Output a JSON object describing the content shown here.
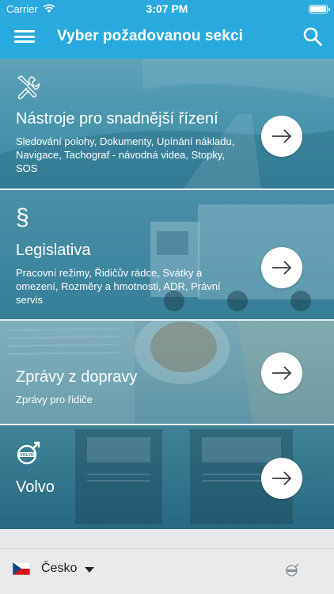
{
  "status_bar": {
    "carrier": "Carrier",
    "time": "3:07 PM"
  },
  "nav": {
    "title": "Vyber požadovanou sekci",
    "menu_icon": "hamburger-menu-icon",
    "search_icon": "search-icon"
  },
  "sections": [
    {
      "icon": "tools-icon",
      "title": "Nástroje pro snadnější řízení",
      "description": "Sledování polohy, Dokumenty, Upínání nákladu, Navigace, Tachograf - návodná videa, Stopky, SOS"
    },
    {
      "icon": "paragraph-icon",
      "icon_glyph": "§",
      "title": "Legislativa",
      "description": "Pracovní režimy, Řidičův rádce, Svátky a omezení, Rozměry a hmotnosti, ADR, Právní servis"
    },
    {
      "title": "Zprávy z dopravy",
      "description": "Zprávy pro řidiče"
    },
    {
      "icon": "volvo-logo-icon",
      "logo_text": "VOLVO",
      "title": "Volvo"
    }
  ],
  "bottom_bar": {
    "language": "Česko",
    "flag_icon": "czech-flag-icon",
    "brand_icon": "volvo-logo-icon"
  },
  "colors": {
    "accent": "#29a9dd",
    "bottom_bar": "#e9eaec"
  }
}
